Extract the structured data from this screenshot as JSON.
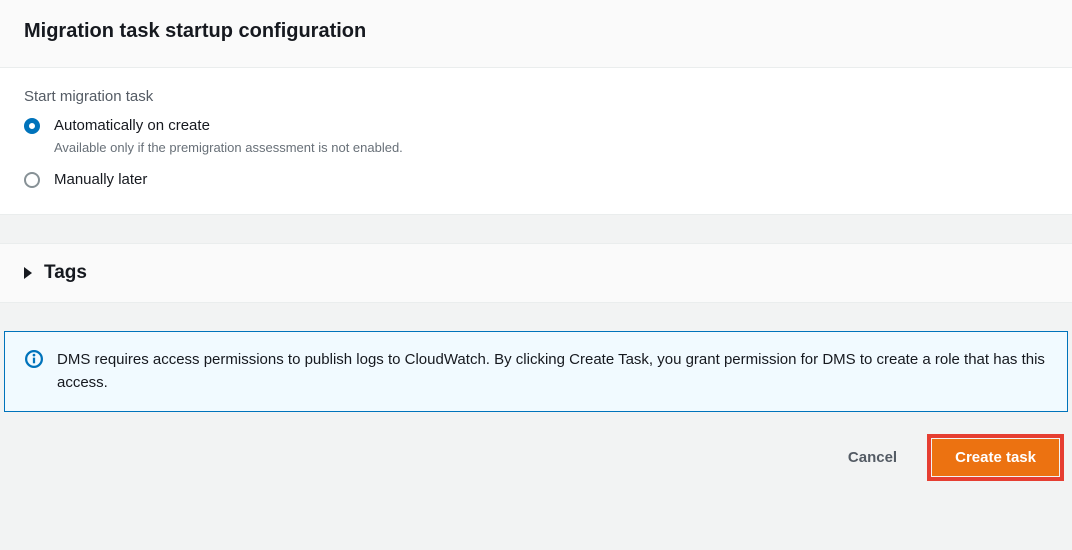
{
  "header": {
    "title": "Migration task startup configuration"
  },
  "form": {
    "label": "Start migration task",
    "options": [
      {
        "label": "Automatically on create",
        "description": "Available only if the premigration assessment is not enabled.",
        "selected": true
      },
      {
        "label": "Manually later",
        "description": "",
        "selected": false
      }
    ]
  },
  "tags": {
    "label": "Tags"
  },
  "alert": {
    "text": "DMS requires access permissions to publish logs to CloudWatch. By clicking Create Task, you grant permission for DMS to create a role that has this access."
  },
  "actions": {
    "cancel": "Cancel",
    "create": "Create task"
  }
}
